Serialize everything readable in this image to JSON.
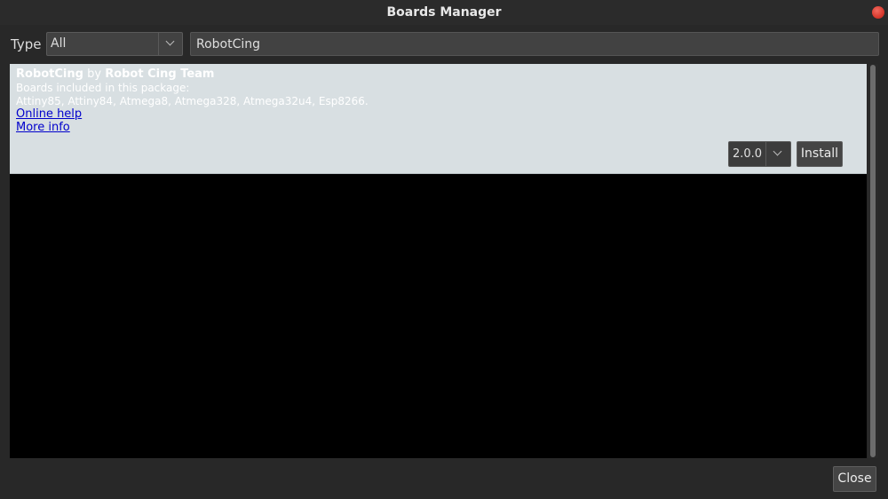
{
  "window": {
    "title": "Boards Manager"
  },
  "filter": {
    "type_label": "Type",
    "type_value": "All",
    "search_value": "RobotCing"
  },
  "package": {
    "name": "RobotCing",
    "by": "by",
    "author": "Robot Cing Team",
    "boards_heading": "Boards included in this package:",
    "boards_list": "Attiny85, Attiny84, Atmega8, Atmega328, Atmega32u4, Esp8266.",
    "online_help": "Online help",
    "more_info": "More info",
    "version": "2.0.0",
    "install_label": "Install"
  },
  "footer": {
    "close_label": "Close"
  },
  "colors": {
    "window_bg": "#282828",
    "entry_bg": "#d8dfe2",
    "list_bg": "#000000",
    "link": "#0000cc",
    "close_dot": "#d83a2e"
  },
  "icons": {
    "window_close": "close-dot-icon",
    "type_dropdown": "chevron-down-icon",
    "version_dropdown": "chevron-down-icon"
  }
}
